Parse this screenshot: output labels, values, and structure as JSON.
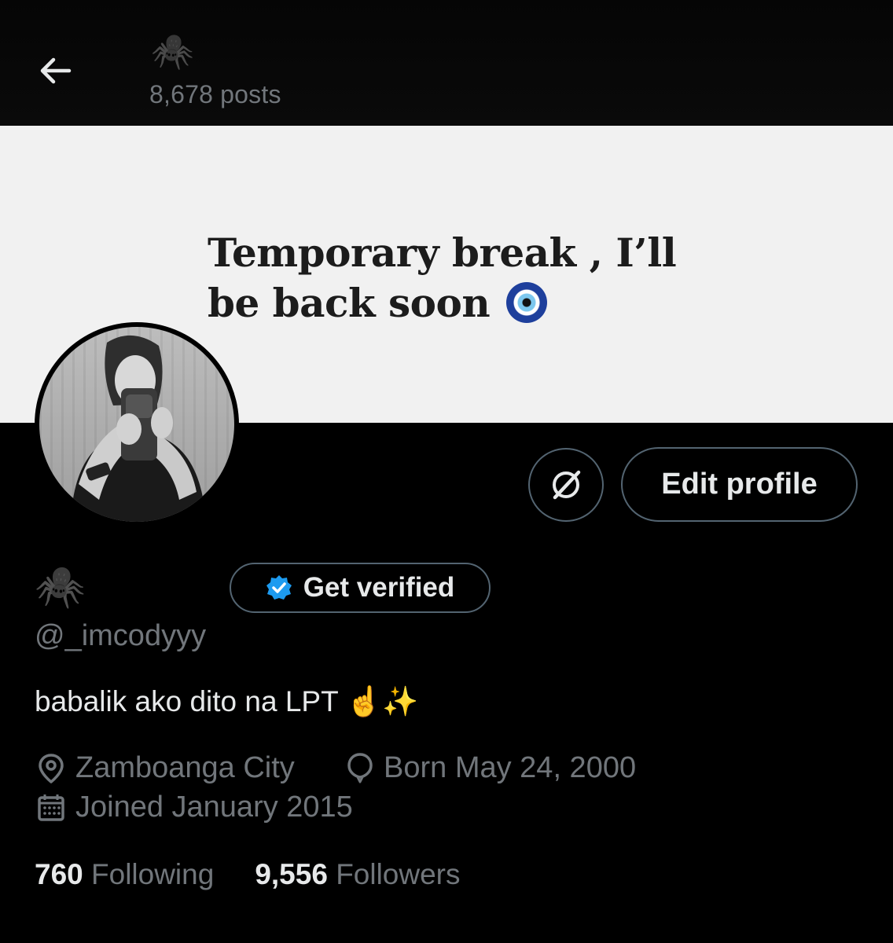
{
  "header": {
    "display_name": "🕷️",
    "posts_count": "8,678 posts"
  },
  "banner": {
    "line1": "Temporary break , I’ll",
    "line2": "be back soon"
  },
  "actions": {
    "edit_profile_label": "Edit profile",
    "get_verified_label": "Get verified"
  },
  "profile": {
    "display_name": "🕷️",
    "handle": "@_imcodyyy",
    "bio": "babalik ako dito na LPT ☝️✨",
    "location": "Zamboanga City",
    "birthday": "Born May 24, 2000",
    "joined": "Joined January 2015"
  },
  "stats": {
    "following_count": "760",
    "following_label": "Following",
    "followers_count": "9,556",
    "followers_label": "Followers"
  },
  "icons": {
    "back": "arrow-left-icon",
    "grok": "grok-icon",
    "verified": "verified-badge-icon",
    "location": "location-pin-icon",
    "birthday": "balloon-icon",
    "calendar": "calendar-icon"
  },
  "colors": {
    "background": "#000000",
    "text_primary": "#e7e9ea",
    "text_secondary": "#71767b",
    "border": "#536471",
    "verified_blue": "#1d9bf0"
  }
}
